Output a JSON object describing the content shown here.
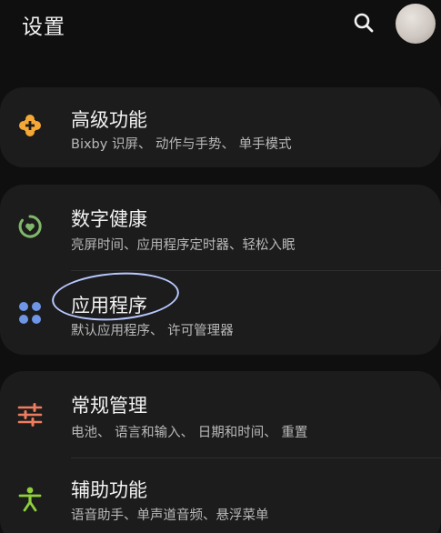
{
  "header": {
    "title": "设置"
  },
  "colors": {
    "advanced_icon": "#f4a836",
    "wellbeing_icon": "#7fb86a",
    "apps_icon": "#6e95e6",
    "general_icon": "#ef7c5f",
    "accessibility_icon": "#8fcf3c",
    "highlight_oval": "#b8c8ff"
  },
  "icons": {
    "search": "search-icon",
    "advanced": "puzzle-plus-icon",
    "wellbeing": "digital-wellbeing-icon",
    "apps": "apps-grid-icon",
    "general": "sliders-icon",
    "accessibility": "accessibility-person-icon"
  },
  "items": [
    {
      "title": "高级功能",
      "subtitle": "Bixby 识屏、 动作与手势、 单手模式"
    },
    {
      "title": "数字健康",
      "subtitle": "亮屏时间、应用程序定时器、轻松入眠"
    },
    {
      "title": "应用程序",
      "subtitle": "默认应用程序、 许可管理器"
    },
    {
      "title": "常规管理",
      "subtitle": "电池、 语言和输入、 日期和时间、 重置"
    },
    {
      "title": "辅助功能",
      "subtitle": "语音助手、单声道音频、悬浮菜单"
    }
  ]
}
